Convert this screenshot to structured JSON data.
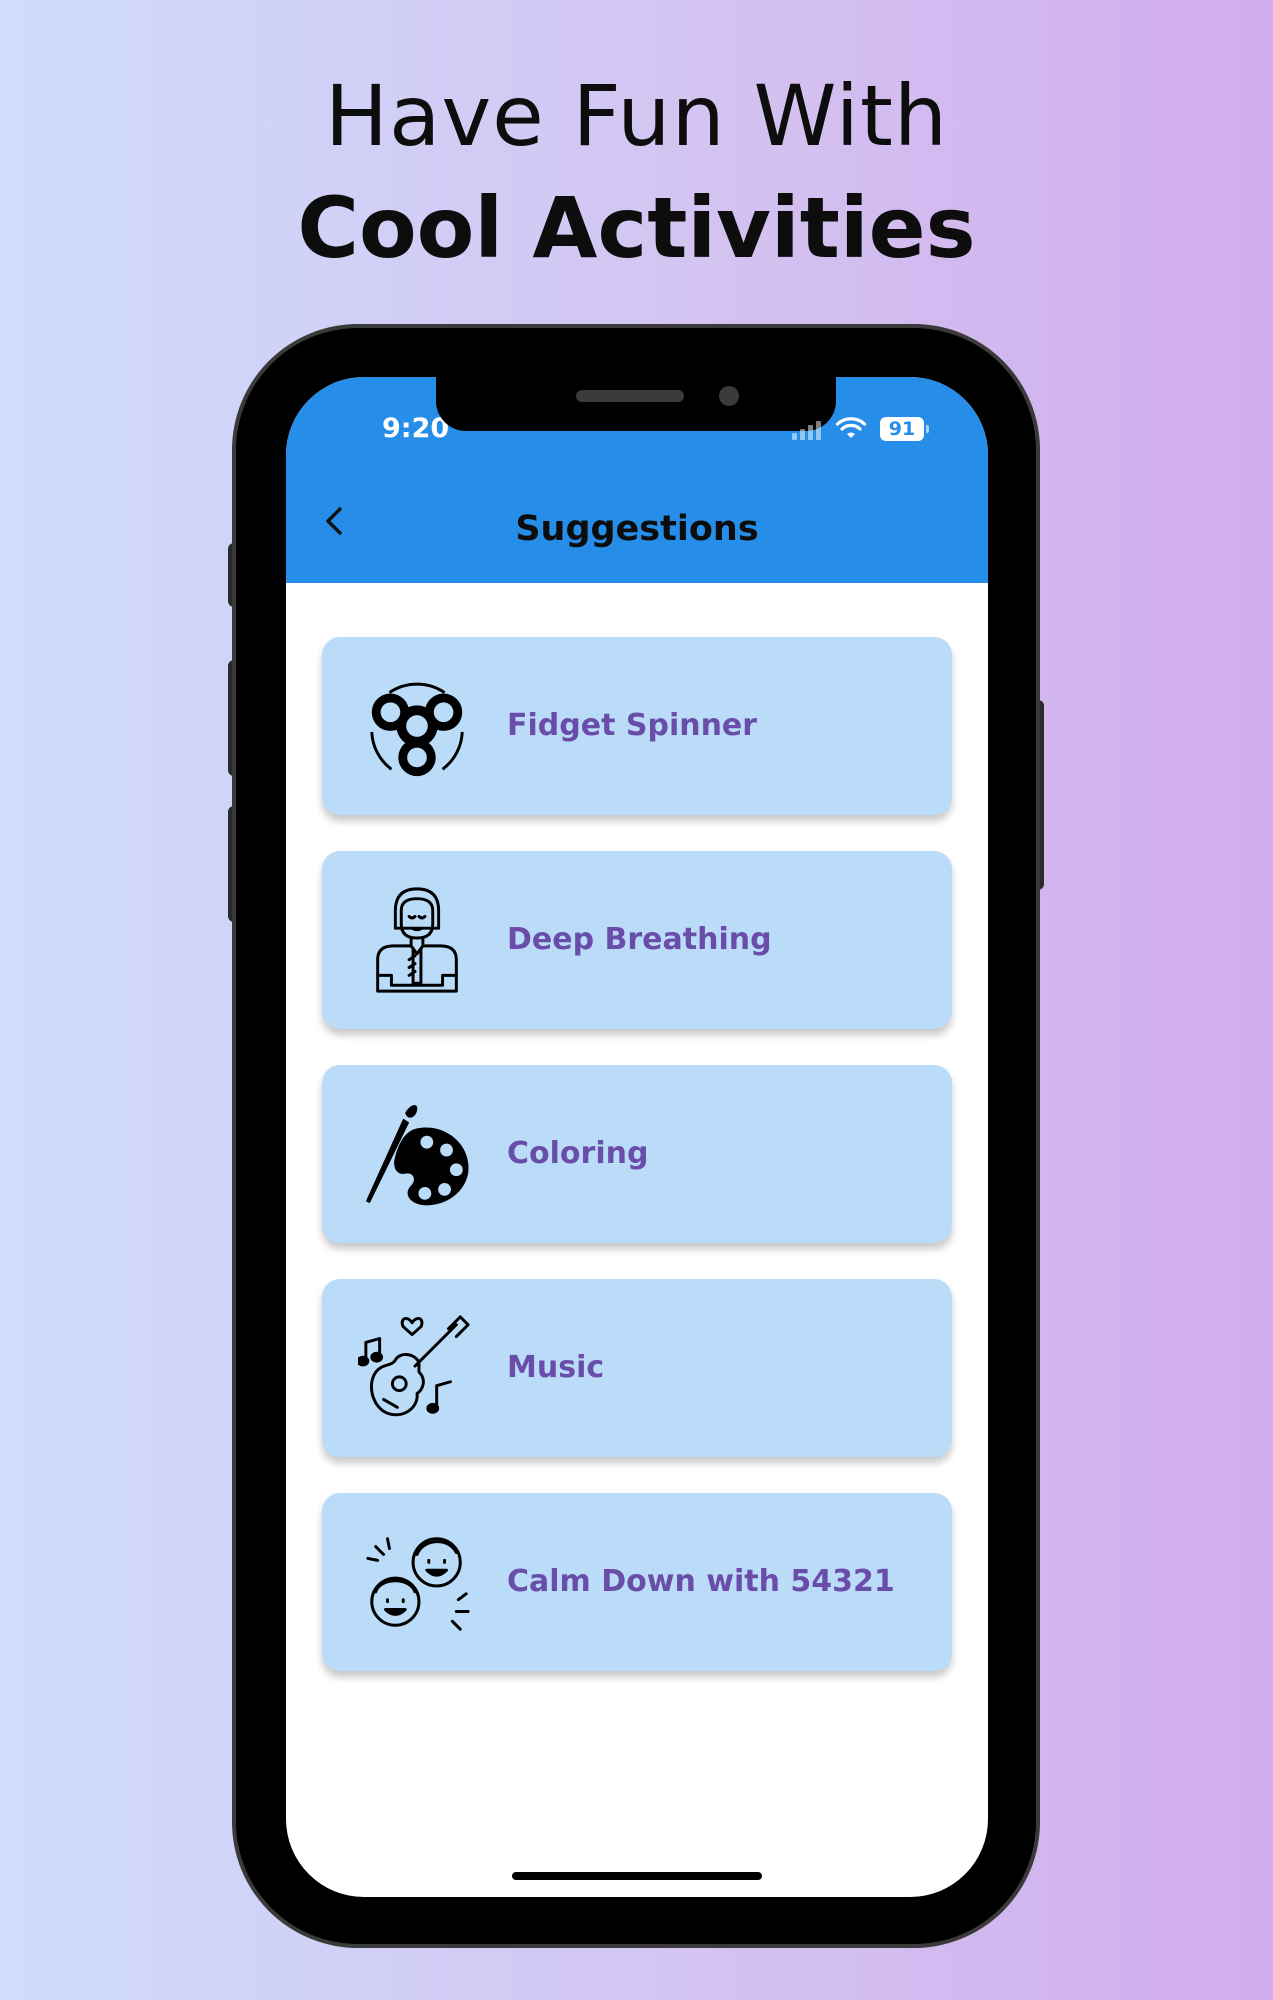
{
  "headline": {
    "line1": "Have Fun With",
    "line2": "Cool Activities"
  },
  "status_bar": {
    "time": "9:20",
    "battery": "91"
  },
  "app_bar": {
    "title": "Suggestions"
  },
  "activities": [
    {
      "label": "Fidget Spinner",
      "icon": "fidget-spinner-icon"
    },
    {
      "label": "Deep Breathing",
      "icon": "meditating-person-icon"
    },
    {
      "label": "Coloring",
      "icon": "paint-palette-icon"
    },
    {
      "label": "Music",
      "icon": "guitar-music-icon"
    },
    {
      "label": "Calm Down with 54321",
      "icon": "happy-faces-icon"
    }
  ],
  "colors": {
    "app_bar": "#268ee9",
    "card_background": "#badcf8",
    "card_label": "#6a4da8"
  }
}
